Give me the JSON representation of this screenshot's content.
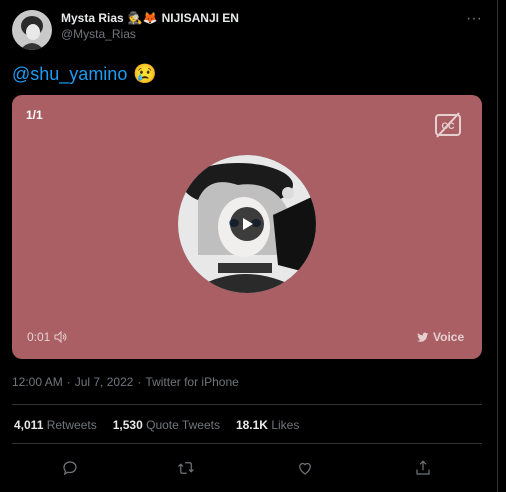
{
  "author": {
    "display_name": "Mysta Rias",
    "name_emojis": "🕵️🦊",
    "name_suffix": "NIJISANJI EN",
    "handle": "@Mysta_Rias"
  },
  "tweet": {
    "mention": "@shu_yamino",
    "emoji": "😢"
  },
  "media": {
    "counter": "1/1",
    "duration": "0:01",
    "label": "Voice",
    "colors": {
      "background": "#aa5f64"
    }
  },
  "meta": {
    "time": "12:00 AM",
    "dot1": "·",
    "date": "Jul 7, 2022",
    "dot2": "·",
    "source": "Twitter for iPhone"
  },
  "stats": {
    "retweets_count": "4,011",
    "retweets_label": "Retweets",
    "quotes_count": "1,530",
    "quotes_label": "Quote Tweets",
    "likes_count": "18.1K",
    "likes_label": "Likes"
  },
  "actions": [
    "reply-icon",
    "retweet-icon",
    "like-icon",
    "share-icon"
  ],
  "colors": {
    "link": "#1d9bf0",
    "muted": "#71767b",
    "background": "#000000"
  }
}
